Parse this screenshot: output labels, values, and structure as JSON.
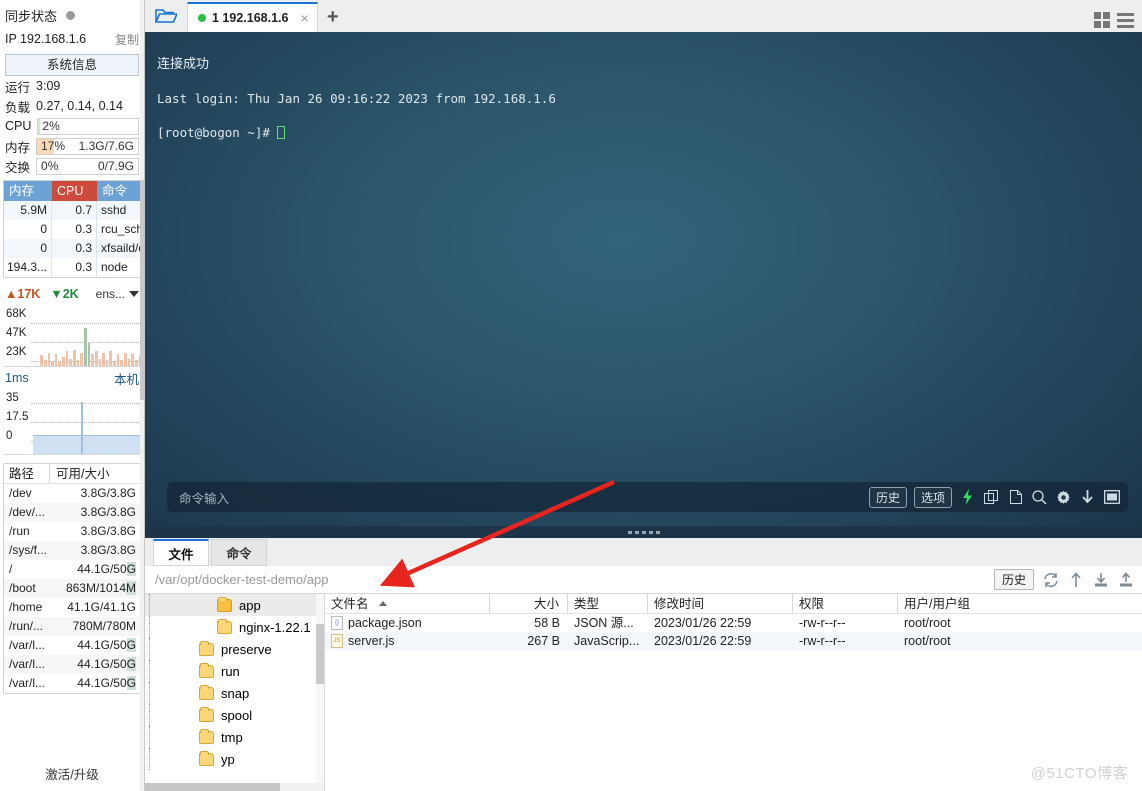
{
  "sidebar": {
    "sync_status_label": "同步状态",
    "ip_label": "IP 192.168.1.6",
    "copy_label": "复制",
    "system_info_button": "系统信息",
    "uptime_label": "运行",
    "uptime_value": "3:09",
    "load_label": "负载",
    "load_value": "0.27, 0.14, 0.14",
    "cpu_label": "CPU",
    "cpu_percent": "2%",
    "cpu_percent_num": 2,
    "mem_label": "内存",
    "mem_percent": "17%",
    "mem_percent_num": 17,
    "mem_detail": "1.3G/7.6G",
    "swap_label": "交换",
    "swap_percent": "0%",
    "swap_percent_num": 0,
    "swap_detail": "0/7.9G",
    "proc_headers": {
      "mem": "内存",
      "cpu": "CPU",
      "cmd": "命令"
    },
    "processes": [
      {
        "mem": "5.9M",
        "cpu": "0.7",
        "cmd": "sshd"
      },
      {
        "mem": "0",
        "cpu": "0.3",
        "cmd": "rcu_sche"
      },
      {
        "mem": "0",
        "cpu": "0.3",
        "cmd": "xfsaild/d"
      },
      {
        "mem": "194.3...",
        "cpu": "0.3",
        "cmd": "node"
      }
    ],
    "net": {
      "up_value": "17K",
      "down_value": "2K",
      "interface": "ens...",
      "y_labels": [
        "68K",
        "47K",
        "23K"
      ]
    },
    "latency": {
      "left_label": "1ms",
      "right_label": "本机",
      "y_labels": [
        "35",
        "17.5",
        "0"
      ]
    },
    "disk_headers": {
      "path": "路径",
      "size": "可用/大小"
    },
    "disks": [
      {
        "path": "/dev",
        "size": "3.8G/3.8G",
        "hl": false
      },
      {
        "path": "/dev/...",
        "size": "3.8G/3.8G",
        "hl": false
      },
      {
        "path": "/run",
        "size": "3.8G/3.8G",
        "hl": false
      },
      {
        "path": "/sys/f...",
        "size": "3.8G/3.8G",
        "hl": false
      },
      {
        "path": "/",
        "size": "44.1G/50G",
        "hl": true
      },
      {
        "path": "/boot",
        "size": "863M/1014M",
        "hl": true
      },
      {
        "path": "/home",
        "size": "41.1G/41.1G",
        "hl": false
      },
      {
        "path": "/run/...",
        "size": "780M/780M",
        "hl": false
      },
      {
        "path": "/var/l...",
        "size": "44.1G/50G",
        "hl": true
      },
      {
        "path": "/var/l...",
        "size": "44.1G/50G",
        "hl": true
      },
      {
        "path": "/var/l...",
        "size": "44.1G/50G",
        "hl": true
      }
    ],
    "activate_label": "激活/升级"
  },
  "tabbar": {
    "folder_icon": "folder-open-icon",
    "tab_label": "1 192.168.1.6",
    "close_icon": "×",
    "plus_icon": "+",
    "grid_icon": "grid-view-icon",
    "menu_icon": "hamburger-menu-icon"
  },
  "terminal": {
    "line_connected": "连接成功",
    "line_lastlogin": "Last login: Thu Jan 26 09:16:22 2023 from 192.168.1.6",
    "line_prompt": "[root@bogon ~]# ",
    "command_placeholder": "命令输入",
    "history_button": "历史",
    "options_button": "选项",
    "icons": [
      "lightning-icon",
      "copy-icon",
      "paste-icon",
      "search-icon",
      "gear-icon",
      "download-icon",
      "window-icon"
    ]
  },
  "filepanel": {
    "tabs": [
      {
        "label": "文件",
        "active": true
      },
      {
        "label": "命令",
        "active": false
      }
    ],
    "path": "/var/opt/docker-test-demo/app",
    "history_button": "历史",
    "tool_icons": [
      "refresh-icon",
      "parent-dir-icon",
      "download-icon",
      "upload-icon"
    ],
    "tree": [
      {
        "label": "app",
        "depth": 3,
        "selected": true,
        "open": true
      },
      {
        "label": "nginx-1.22.1",
        "depth": 3,
        "selected": false,
        "open": false
      },
      {
        "label": "preserve",
        "depth": 2,
        "selected": false,
        "open": false
      },
      {
        "label": "run",
        "depth": 2,
        "selected": false,
        "open": false
      },
      {
        "label": "snap",
        "depth": 2,
        "selected": false,
        "open": false
      },
      {
        "label": "spool",
        "depth": 2,
        "selected": false,
        "open": false
      },
      {
        "label": "tmp",
        "depth": 2,
        "selected": false,
        "open": false
      },
      {
        "label": "yp",
        "depth": 2,
        "selected": false,
        "open": false
      }
    ],
    "columns": [
      "文件名",
      "大小",
      "类型",
      "修改时间",
      "权限",
      "用户/用户组"
    ],
    "files": [
      {
        "icon": "json-file-icon",
        "name": "package.json",
        "size": "58 B",
        "type": "JSON 源...",
        "mtime": "2023/01/26 22:59",
        "perm": "-rw-r--r--",
        "owner": "root/root"
      },
      {
        "icon": "js-file-icon",
        "name": "server.js",
        "size": "267 B",
        "type": "JavaScrip...",
        "mtime": "2023/01/26 22:59",
        "perm": "-rw-r--r--",
        "owner": "root/root"
      }
    ]
  },
  "watermark": "@51CTO博客",
  "colors": {
    "accent": "#1a74d4",
    "tab_dot_green": "#27c13f",
    "cpu_header": "#cc4b3c",
    "mem_header": "#6da2d4",
    "terminal_bg": "#2c566c",
    "arrow_red": "#e8241e"
  }
}
